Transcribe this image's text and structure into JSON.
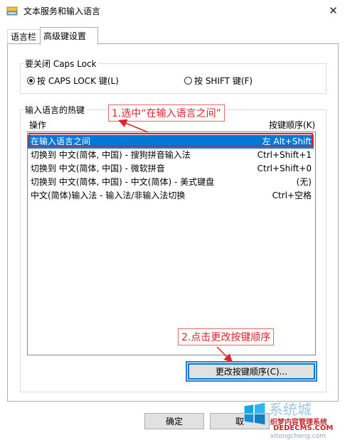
{
  "window": {
    "title": "文本服务和输入语言",
    "close_glyph": "✕"
  },
  "tabs": [
    {
      "label": "语言栏"
    },
    {
      "label": "高级键设置"
    }
  ],
  "caps_group": {
    "legend": "要关闭 Caps Lock",
    "options": [
      {
        "label": "按 CAPS LOCK 键(L)",
        "selected": true
      },
      {
        "label": "按 SHIFT 键(F)",
        "selected": false
      }
    ]
  },
  "hotkeys_group": {
    "legend": "输入语言的热键",
    "col_action": "操作",
    "col_keys": "按键顺序(K)",
    "rows": [
      {
        "action": "在输入语言之间",
        "keys": "左 Alt+Shift",
        "selected": true
      },
      {
        "action": "切换到 中文(简体, 中国) - 搜狗拼音输入法",
        "keys": "Ctrl+Shift+1",
        "selected": false
      },
      {
        "action": "切换到 中文(简体, 中国) - 微软拼音",
        "keys": "Ctrl+Shift+0",
        "selected": false
      },
      {
        "action": "切换到 中文(简体, 中国) - 中文(简体) - 美式键盘",
        "keys": "(无)",
        "selected": false
      },
      {
        "action": "中文(简体)输入法 - 输入法/非输入法切换",
        "keys": "Ctrl+空格",
        "selected": false
      }
    ],
    "change_button": "更改按键顺序(C)..."
  },
  "annotations": {
    "step1": "1.选中“在输入语言之间”",
    "step2": "2.点击更改按键顺序",
    "color": "#d9252b"
  },
  "footer": {
    "ok": "确定",
    "cancel": "取"
  },
  "watermark": {
    "line1": "系统城",
    "line2": "织梦内容管理系统",
    "line3": "DEDECMS.COM",
    "line4": "xitongcheng.com"
  },
  "colors": {
    "selection": "#0078d7",
    "frame": "#e0202a"
  }
}
